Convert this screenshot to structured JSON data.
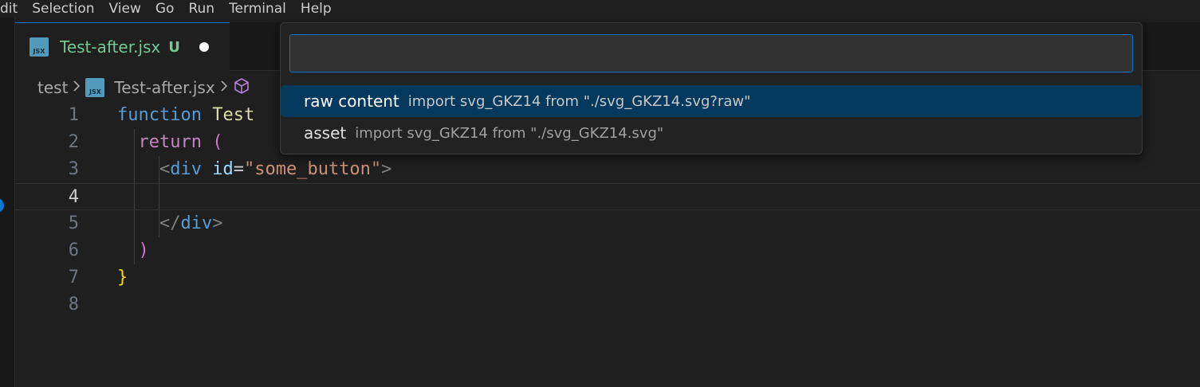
{
  "menubar": {
    "items": [
      "dit",
      "Selection",
      "View",
      "Go",
      "Run",
      "Terminal",
      "Help"
    ]
  },
  "tab": {
    "icon_text": "JSX",
    "label": "Test-after.jsx",
    "badge": "U"
  },
  "breadcrumb": {
    "folder": "test",
    "file": "Test-after.jsx"
  },
  "editor": {
    "line_numbers": [
      "1",
      "2",
      "3",
      "4",
      "5",
      "6",
      "7",
      "8"
    ],
    "active_line": 4,
    "code": {
      "l1_kw": "function",
      "l1_name": "Test",
      "l2_kw": "return",
      "l2_paren": "(",
      "l3_open": "<",
      "l3_tag": "div",
      "l3_attr": "id",
      "l3_eq": "=",
      "l3_str": "\"some_button\"",
      "l3_close": ">",
      "l5_open": "</",
      "l5_tag": "div",
      "l5_close": ">",
      "l6_paren": ")",
      "l7_brace": "}"
    }
  },
  "quick_pick": {
    "input_value": "",
    "items": [
      {
        "label": "raw content",
        "description": "import svg_GKZ14 from \"./svg_GKZ14.svg?raw\""
      },
      {
        "label": "asset",
        "description": "import svg_GKZ14 from \"./svg_GKZ14.svg\""
      }
    ],
    "selected_index": 0
  },
  "colors": {
    "accent": "#0078d4",
    "selection": "#04395e",
    "untracked": "#73c991"
  }
}
